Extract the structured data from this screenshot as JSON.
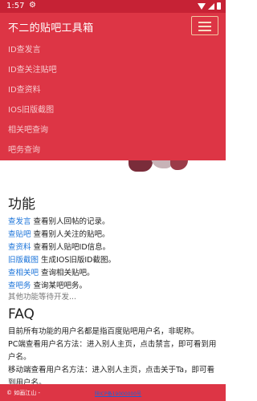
{
  "status": {
    "time": "1:57"
  },
  "nav": {
    "brand": "不二的贴吧工具箱",
    "items": [
      {
        "label": "ID查发言"
      },
      {
        "label": "ID查关注贴吧"
      },
      {
        "label": "ID查资料"
      },
      {
        "label": "IOS旧版截图"
      },
      {
        "label": "相关吧查询"
      },
      {
        "label": "吧务查询"
      }
    ]
  },
  "features": {
    "title": "功能",
    "list": [
      {
        "link": "查发言",
        "desc": " 查看别人回帖的记录。"
      },
      {
        "link": "查贴吧",
        "desc": " 查看别人关注的贴吧。"
      },
      {
        "link": "查资料",
        "desc": " 查看别人贴吧ID信息。"
      },
      {
        "link": "旧版截图",
        "desc": " 生成IOS旧版ID截图。"
      },
      {
        "link": "查相关吧",
        "desc": " 查询相关贴吧。"
      },
      {
        "link": "查吧务",
        "desc": " 查询某吧吧务。"
      }
    ],
    "more": "其他功能等待开发..."
  },
  "faq": {
    "title": "FAQ",
    "p1": "目前所有功能的用户名都是指百度贴吧用户名，非昵称。",
    "p2": "PC端查看用户名方法：进入别人主页，点击禁言，即可看到用户名。",
    "p3": "移动端查看用户名方法：进入别人主页，点击关于Ta，即可看到用户名。"
  },
  "footer": {
    "copyright": "© 如画江山 -",
    "link": "陕ICP备19000000号"
  },
  "colors": {
    "navbar": "#dd3545",
    "status": "#c62235",
    "link": "#1a73d9"
  }
}
